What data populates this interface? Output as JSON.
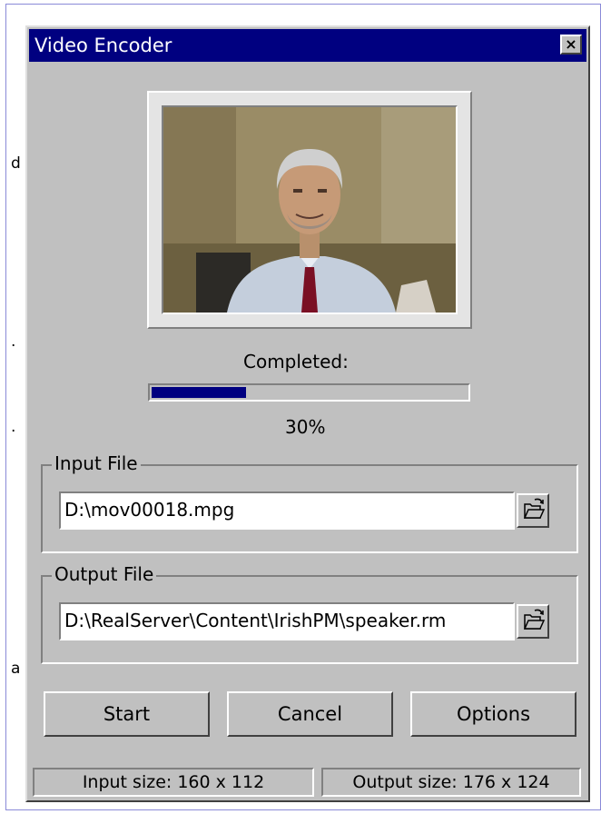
{
  "window": {
    "title": "Video Encoder",
    "close_glyph": "×",
    "close_icon": "close-icon"
  },
  "background_fragments": [
    "d",
    ".",
    ".",
    "a"
  ],
  "preview": {
    "content": "video frame of a grey-haired man in a light blue shirt and red tie"
  },
  "progress": {
    "label": "Completed:",
    "value_text": "30%",
    "fraction": 0.3,
    "fill_color": "#000080"
  },
  "input_group": {
    "legend": "Input File",
    "path": "D:\\mov00018.mpg",
    "browse_icon": "open-folder-icon"
  },
  "output_group": {
    "legend": "Output File",
    "path": "D:\\RealServer\\Content\\IrishPM\\speaker.rm",
    "browse_icon": "open-folder-icon"
  },
  "buttons": {
    "start": "Start",
    "cancel": "Cancel",
    "options": "Options"
  },
  "status_bar": {
    "input_size": "Input size: 160 x 112",
    "output_size": "Output size: 176 x 124"
  },
  "colors": {
    "titlebar": "#000080",
    "face": "#c0c0c0"
  }
}
